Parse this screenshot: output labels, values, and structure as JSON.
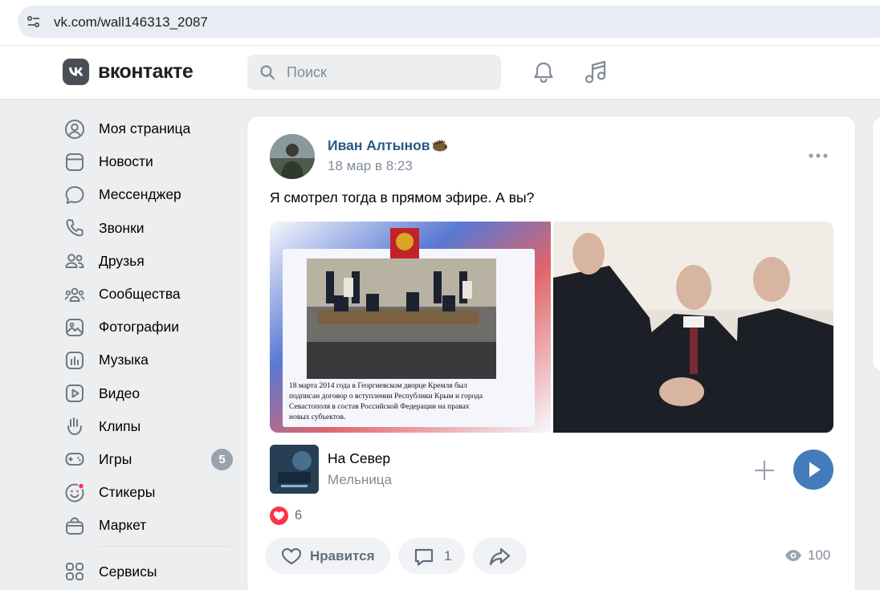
{
  "browser": {
    "url": "vk.com/wall146313_2087"
  },
  "header": {
    "logo_text": "вконтакте",
    "search_placeholder": "Поиск"
  },
  "sidebar": {
    "items": [
      {
        "label": "Моя страница",
        "icon": "user-circle-icon"
      },
      {
        "label": "Новости",
        "icon": "newsfeed-icon"
      },
      {
        "label": "Мессенджер",
        "icon": "message-bubble-icon"
      },
      {
        "label": "Звонки",
        "icon": "phone-icon"
      },
      {
        "label": "Друзья",
        "icon": "friends-icon"
      },
      {
        "label": "Сообщества",
        "icon": "communities-icon"
      },
      {
        "label": "Фотографии",
        "icon": "photos-icon"
      },
      {
        "label": "Музыка",
        "icon": "music-bars-icon"
      },
      {
        "label": "Видео",
        "icon": "video-play-icon"
      },
      {
        "label": "Клипы",
        "icon": "clips-icon"
      },
      {
        "label": "Игры",
        "icon": "gamepad-icon",
        "badge": "5"
      },
      {
        "label": "Стикеры",
        "icon": "sticker-smile-icon"
      },
      {
        "label": "Маркет",
        "icon": "market-bag-icon"
      }
    ],
    "services_label": "Сервисы"
  },
  "post": {
    "author": "Иван Алтынов",
    "date": "18 мар в 8:23",
    "text": "Я смотрел тогда в прямом эфире. А вы?",
    "photo_caption": "18 марта 2014 года в Георгиевском дворце Кремля был подписан договор о вступлении Республики Крым и города Севастополя в состав Российской Федерации на правах новых субъектов.",
    "audio": {
      "title": "На Север",
      "artist": "Мельница"
    },
    "likes": "6",
    "like_label": "Нравится",
    "comments": "1",
    "views": "100"
  },
  "colors": {
    "accent": "#447bba",
    "author_link": "#2a5885",
    "like": "#ff3347",
    "secondary_text": "#818c99"
  }
}
